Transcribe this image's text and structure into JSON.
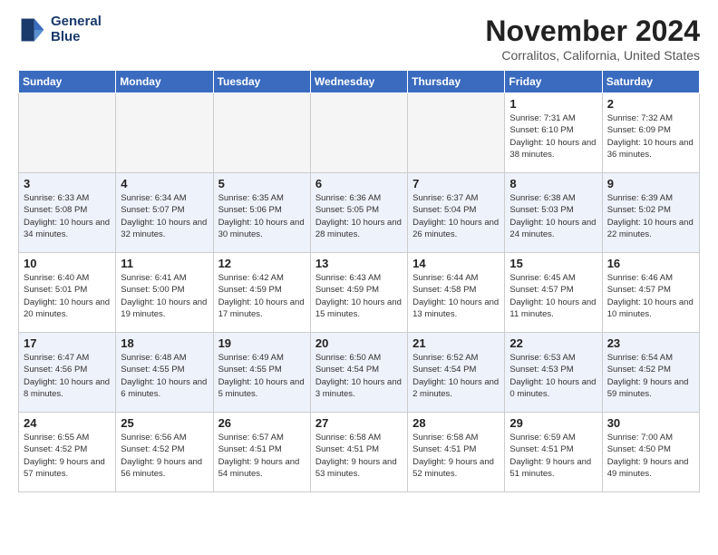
{
  "header": {
    "logo_line1": "General",
    "logo_line2": "Blue",
    "month": "November 2024",
    "location": "Corralitos, California, United States"
  },
  "weekdays": [
    "Sunday",
    "Monday",
    "Tuesday",
    "Wednesday",
    "Thursday",
    "Friday",
    "Saturday"
  ],
  "weeks": [
    [
      {
        "day": "",
        "info": ""
      },
      {
        "day": "",
        "info": ""
      },
      {
        "day": "",
        "info": ""
      },
      {
        "day": "",
        "info": ""
      },
      {
        "day": "",
        "info": ""
      },
      {
        "day": "1",
        "info": "Sunrise: 7:31 AM\nSunset: 6:10 PM\nDaylight: 10 hours and 38 minutes."
      },
      {
        "day": "2",
        "info": "Sunrise: 7:32 AM\nSunset: 6:09 PM\nDaylight: 10 hours and 36 minutes."
      }
    ],
    [
      {
        "day": "3",
        "info": "Sunrise: 6:33 AM\nSunset: 5:08 PM\nDaylight: 10 hours and 34 minutes."
      },
      {
        "day": "4",
        "info": "Sunrise: 6:34 AM\nSunset: 5:07 PM\nDaylight: 10 hours and 32 minutes."
      },
      {
        "day": "5",
        "info": "Sunrise: 6:35 AM\nSunset: 5:06 PM\nDaylight: 10 hours and 30 minutes."
      },
      {
        "day": "6",
        "info": "Sunrise: 6:36 AM\nSunset: 5:05 PM\nDaylight: 10 hours and 28 minutes."
      },
      {
        "day": "7",
        "info": "Sunrise: 6:37 AM\nSunset: 5:04 PM\nDaylight: 10 hours and 26 minutes."
      },
      {
        "day": "8",
        "info": "Sunrise: 6:38 AM\nSunset: 5:03 PM\nDaylight: 10 hours and 24 minutes."
      },
      {
        "day": "9",
        "info": "Sunrise: 6:39 AM\nSunset: 5:02 PM\nDaylight: 10 hours and 22 minutes."
      }
    ],
    [
      {
        "day": "10",
        "info": "Sunrise: 6:40 AM\nSunset: 5:01 PM\nDaylight: 10 hours and 20 minutes."
      },
      {
        "day": "11",
        "info": "Sunrise: 6:41 AM\nSunset: 5:00 PM\nDaylight: 10 hours and 19 minutes."
      },
      {
        "day": "12",
        "info": "Sunrise: 6:42 AM\nSunset: 4:59 PM\nDaylight: 10 hours and 17 minutes."
      },
      {
        "day": "13",
        "info": "Sunrise: 6:43 AM\nSunset: 4:59 PM\nDaylight: 10 hours and 15 minutes."
      },
      {
        "day": "14",
        "info": "Sunrise: 6:44 AM\nSunset: 4:58 PM\nDaylight: 10 hours and 13 minutes."
      },
      {
        "day": "15",
        "info": "Sunrise: 6:45 AM\nSunset: 4:57 PM\nDaylight: 10 hours and 11 minutes."
      },
      {
        "day": "16",
        "info": "Sunrise: 6:46 AM\nSunset: 4:57 PM\nDaylight: 10 hours and 10 minutes."
      }
    ],
    [
      {
        "day": "17",
        "info": "Sunrise: 6:47 AM\nSunset: 4:56 PM\nDaylight: 10 hours and 8 minutes."
      },
      {
        "day": "18",
        "info": "Sunrise: 6:48 AM\nSunset: 4:55 PM\nDaylight: 10 hours and 6 minutes."
      },
      {
        "day": "19",
        "info": "Sunrise: 6:49 AM\nSunset: 4:55 PM\nDaylight: 10 hours and 5 minutes."
      },
      {
        "day": "20",
        "info": "Sunrise: 6:50 AM\nSunset: 4:54 PM\nDaylight: 10 hours and 3 minutes."
      },
      {
        "day": "21",
        "info": "Sunrise: 6:52 AM\nSunset: 4:54 PM\nDaylight: 10 hours and 2 minutes."
      },
      {
        "day": "22",
        "info": "Sunrise: 6:53 AM\nSunset: 4:53 PM\nDaylight: 10 hours and 0 minutes."
      },
      {
        "day": "23",
        "info": "Sunrise: 6:54 AM\nSunset: 4:52 PM\nDaylight: 9 hours and 59 minutes."
      }
    ],
    [
      {
        "day": "24",
        "info": "Sunrise: 6:55 AM\nSunset: 4:52 PM\nDaylight: 9 hours and 57 minutes."
      },
      {
        "day": "25",
        "info": "Sunrise: 6:56 AM\nSunset: 4:52 PM\nDaylight: 9 hours and 56 minutes."
      },
      {
        "day": "26",
        "info": "Sunrise: 6:57 AM\nSunset: 4:51 PM\nDaylight: 9 hours and 54 minutes."
      },
      {
        "day": "27",
        "info": "Sunrise: 6:58 AM\nSunset: 4:51 PM\nDaylight: 9 hours and 53 minutes."
      },
      {
        "day": "28",
        "info": "Sunrise: 6:58 AM\nSunset: 4:51 PM\nDaylight: 9 hours and 52 minutes."
      },
      {
        "day": "29",
        "info": "Sunrise: 6:59 AM\nSunset: 4:51 PM\nDaylight: 9 hours and 51 minutes."
      },
      {
        "day": "30",
        "info": "Sunrise: 7:00 AM\nSunset: 4:50 PM\nDaylight: 9 hours and 49 minutes."
      }
    ]
  ]
}
